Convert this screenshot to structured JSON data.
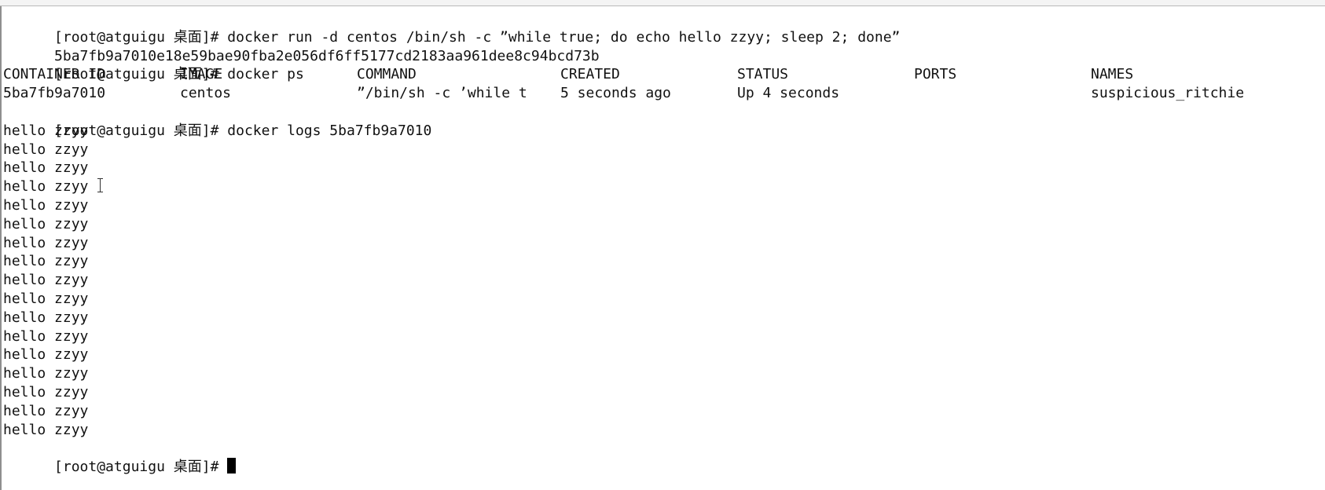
{
  "terminal": {
    "commands": {
      "run": {
        "prompt": "[root@atguigu 桌面]# ",
        "command": "docker run -d centos /bin/sh -c ”while true; do echo hello zzyy; sleep 2; done”"
      },
      "run_output": "5ba7fb9a7010e18e59bae90fba2e056df6ff5177cd2183aa961dee8c94bcd73b",
      "ps": {
        "prompt": "[root@atguigu 桌面]# ",
        "command": "docker ps"
      },
      "logs": {
        "prompt": "[root@atguigu 桌面]# ",
        "command": "docker logs 5ba7fb9a7010"
      },
      "final_prompt": "[root@atguigu 桌面]# "
    },
    "ps_table": {
      "headers": [
        "CONTAINER ID",
        "IMAGE",
        "COMMAND",
        "CREATED",
        "STATUS",
        "PORTS",
        "NAMES"
      ],
      "rows": [
        [
          "5ba7fb9a7010",
          "centos",
          "”/bin/sh -c ’while t",
          "5 seconds ago",
          "Up 4 seconds",
          "",
          "suspicious_ritchie"
        ]
      ]
    },
    "log_lines": [
      "hello zzyy",
      "hello zzyy",
      "hello zzyy",
      "hello zzyy",
      "hello zzyy",
      "hello zzyy",
      "hello zzyy",
      "hello zzyy",
      "hello zzyy",
      "hello zzyy",
      "hello zzyy",
      "hello zzyy",
      "hello zzyy",
      "hello zzyy",
      "hello zzyy",
      "hello zzyy",
      "hello zzyy"
    ],
    "icons": {
      "mouse_pointer": "text-cursor-icon",
      "terminal_cursor": "block-cursor-icon"
    },
    "colors": {
      "background": "#ffffff",
      "text": "#111111",
      "cursor": "#000000"
    }
  }
}
